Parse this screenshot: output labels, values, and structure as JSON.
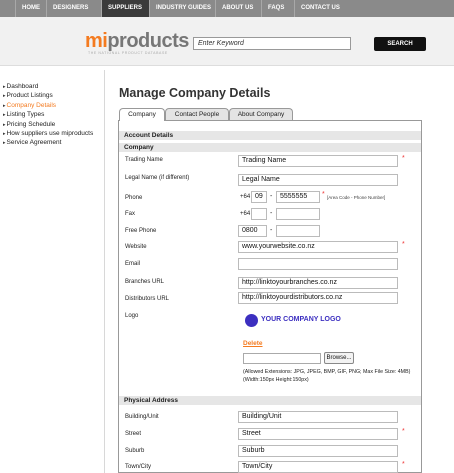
{
  "topnav": {
    "items": [
      "HOME",
      "DESIGNERS",
      "SUPPLIERS",
      "INDUSTRY GUIDES",
      "ABOUT US",
      "FAQS",
      "CONTACT US"
    ]
  },
  "header": {
    "logo_mi": "mi",
    "logo_products": "products",
    "logo_tagline": "THE NATIONAL PRODUCT DATABASE",
    "search_placeholder": "Enter Keyword",
    "search_button": "SEARCH"
  },
  "sidebar": {
    "items": [
      {
        "label": "Dashboard"
      },
      {
        "label": "Product Listings"
      },
      {
        "label": "Company Details"
      },
      {
        "label": "Listing Types"
      },
      {
        "label": "Pricing Schedule"
      },
      {
        "label": "How suppliers use miproducts"
      },
      {
        "label": "Service Agreement"
      }
    ]
  },
  "main": {
    "title": "Manage Company Details",
    "tabs": [
      "Company",
      "Contact People",
      "About Company"
    ]
  },
  "form": {
    "account_section": "Account Details",
    "company_section": "Company",
    "trading_name_label": "Trading Name",
    "trading_name_value": "Trading Name",
    "legal_name_label": "Legal Name (if different)",
    "legal_name_value": "Legal Name",
    "phone_label": "Phone",
    "phone_country": "+64",
    "phone_area": "09",
    "phone_number": "5555555",
    "phone_hint": "[Area Code - Phone Number]",
    "fax_label": "Fax",
    "fax_country": "+64",
    "free_phone_label": "Free Phone",
    "free_phone_prefix": "0800",
    "website_label": "Website",
    "website_value": "www.yourwebsite.co.nz",
    "email_label": "Email",
    "branches_label": "Branches URL",
    "branches_value": "http://linktoyourbranches.co.nz",
    "distributors_label": "Distributors URL",
    "distributors_value": "http://linktoyourdistributors.co.nz",
    "logo_label": "Logo",
    "logo_text": "YOUR COMPANY LOGO",
    "delete_link": "Delete",
    "browse_button": "Browse...",
    "upload_note_1": "(Allowed Extensions: JPG, JPEG, BMP, GIF, PNG; Max File Size: 4MB)",
    "upload_note_2": "(Width:150px Height:150px)",
    "physical_section": "Physical Address",
    "building_label": "Building/Unit",
    "building_value": "Building/Unit",
    "street_label": "Street",
    "street_value": "Street",
    "suburb_label": "Suburb",
    "suburb_value": "Suburb",
    "town_label": "Town/City",
    "town_value": "Town/City",
    "required_mark": "*",
    "dash": "-"
  },
  "colors": {
    "accent": "#f47b20",
    "nav_bg": "#8a8a8a",
    "nav_active": "#3b3b3b",
    "required": "#e33333",
    "logo_blue": "#3c2fc0"
  }
}
